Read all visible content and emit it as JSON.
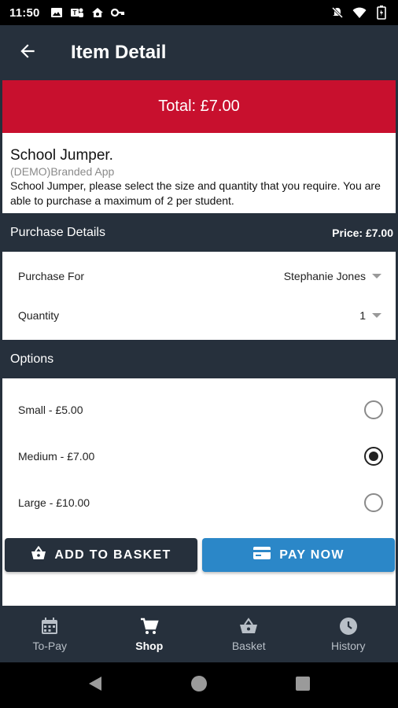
{
  "status_bar": {
    "time": "11:50",
    "left_icons": [
      "image-icon",
      "teams-icon",
      "home-icon",
      "key-icon"
    ],
    "right_icons": [
      "mute-icon",
      "wifi-icon",
      "battery-icon"
    ]
  },
  "app_bar": {
    "title": "Item Detail",
    "back_icon": "arrow-left-icon"
  },
  "total": {
    "label": "Total: £7.00"
  },
  "item": {
    "name": "School Jumper.",
    "shop": "(DEMO)Branded App",
    "description": "School Jumper, please select the size and quantity that you require. You are able to purchase a maximum of 2 per student."
  },
  "purchase_details": {
    "header": "Purchase Details",
    "price": "Price: £7.00",
    "purchase_for_label": "Purchase For",
    "purchase_for_value": "Stephanie Jones",
    "quantity_label": "Quantity",
    "quantity_value": "1"
  },
  "options": {
    "header": "Options",
    "items": [
      {
        "label": "Small - £5.00",
        "selected": false
      },
      {
        "label": "Medium - £7.00",
        "selected": true
      },
      {
        "label": "Large - £10.00",
        "selected": false
      }
    ]
  },
  "actions": {
    "add_to_basket": "ADD TO BASKET",
    "pay_now": "PAY NOW"
  },
  "bottom_nav": {
    "items": [
      {
        "label": "To-Pay",
        "icon": "calendar-icon"
      },
      {
        "label": "Shop",
        "icon": "cart-icon",
        "active": true
      },
      {
        "label": "Basket",
        "icon": "basket-icon"
      },
      {
        "label": "History",
        "icon": "clock-icon"
      }
    ]
  },
  "colors": {
    "primary": "#26303c",
    "accent_red": "#c8102e",
    "pay_blue": "#2b87c8"
  }
}
